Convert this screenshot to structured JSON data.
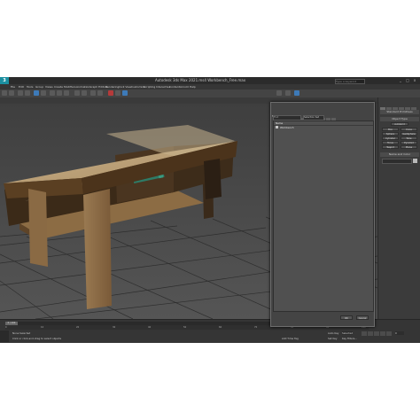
{
  "window": {
    "logo": "3",
    "title": "Autodesk 3ds Max 2021.ms4   Workbench_Free.max",
    "search_placeholder": "Type a keyword",
    "controls": [
      "_",
      "□",
      "x"
    ]
  },
  "menubar": {
    "items": [
      "File",
      "Edit",
      "Tools",
      "Group",
      "Views",
      "Create",
      "Modifiers",
      "Animation",
      "Graph Editors",
      "Rendering",
      "Civil View",
      "Customize",
      "Scripting",
      "Interactive",
      "Content",
      "Arnold",
      "Help"
    ]
  },
  "viewport": {
    "label": "[+] [Perspective] [Standard] [Edged Faces]"
  },
  "dialog": {
    "tabs": [
      "Select",
      "Display",
      "Customize"
    ],
    "search_placeholder": "Find",
    "selection_set": "Selection Set",
    "column_header": "Name",
    "items": [
      "Workbench"
    ],
    "ok_label": "OK",
    "cancel_label": "Cancel"
  },
  "command_panel": {
    "rollout_object_type": "Object Type",
    "autogrid": "AutoGrid",
    "buttons": [
      "Box",
      "Cone",
      "Sphere",
      "GeoSphere",
      "Cylinder",
      "Tube",
      "Torus",
      "Pyramid",
      "Teapot",
      "Plane"
    ],
    "rollout_name_color": "Name and Color",
    "rollout_standard": "Standard Primitives"
  },
  "statusbar": {
    "frame_counter": "0 / 100",
    "selection_text": "None Selected",
    "prompt_text": "Click or click-and-drag to select objects",
    "add_time_tag": "Add Time Tag",
    "auto_key": "Auto Key",
    "selected": "Selected",
    "set_key": "Set Key",
    "key_filters": "Key Filters...",
    "frame": "0",
    "ruler_ticks": [
      "0",
      "10",
      "20",
      "30",
      "40",
      "50",
      "60",
      "70",
      "80",
      "90",
      "100"
    ]
  },
  "colors": {
    "accent": "#3d7ab8",
    "logo": "#1b8fa0",
    "background": "#3d3d3d"
  }
}
